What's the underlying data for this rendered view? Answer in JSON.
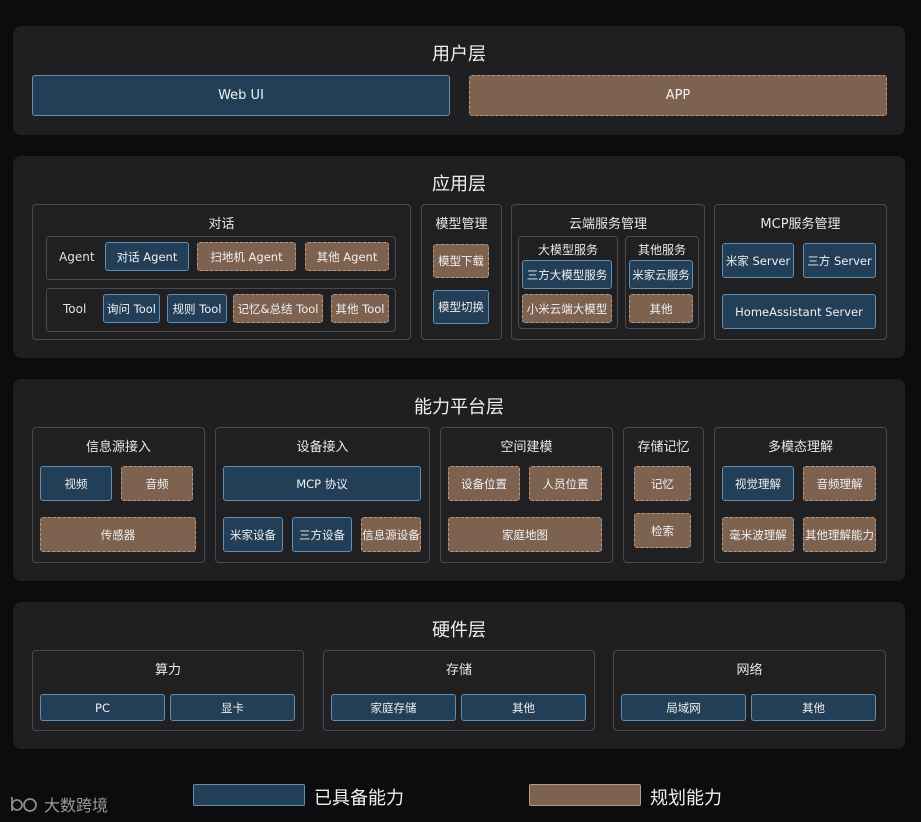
{
  "user_layer": {
    "title": "用户层",
    "web_ui": "Web UI",
    "app": "APP"
  },
  "app_layer": {
    "title": "应用层",
    "dialog": {
      "title": "对话",
      "agent_label": "Agent",
      "tool_label": "Tool",
      "agents": [
        "对话 Agent",
        "扫地机 Agent",
        "其他 Agent"
      ],
      "tools": [
        "询问 Tool",
        "规则 Tool",
        "记忆&总结 Tool",
        "其他 Tool"
      ]
    },
    "model_mgmt": {
      "title": "模型管理",
      "items": [
        "模型下载",
        "模型切换"
      ]
    },
    "cloud": {
      "title": "云端服务管理",
      "llm": {
        "title": "大模型服务",
        "items": [
          "三方大模型服务",
          "小米云端大模型"
        ]
      },
      "other": {
        "title": "其他服务",
        "items": [
          "米家云服务",
          "其他"
        ]
      }
    },
    "mcp": {
      "title": "MCP服务管理",
      "items": [
        "米家 Server",
        "三方 Server",
        "HomeAssistant Server"
      ]
    }
  },
  "platform_layer": {
    "title": "能力平台层",
    "info": {
      "title": "信息源接入",
      "items": [
        "视频",
        "音频",
        "传感器"
      ]
    },
    "device": {
      "title": "设备接入",
      "items": [
        "MCP 协议",
        "米家设备",
        "三方设备",
        "信息源设备"
      ]
    },
    "space": {
      "title": "空间建模",
      "items": [
        "设备位置",
        "人员位置",
        "家庭地图"
      ]
    },
    "memory": {
      "title": "存储记忆",
      "items": [
        "记忆",
        "检索"
      ]
    },
    "multimodal": {
      "title": "多模态理解",
      "items": [
        "视觉理解",
        "音频理解",
        "毫米波理解",
        "其他理解能力"
      ]
    }
  },
  "hardware_layer": {
    "title": "硬件层",
    "compute": {
      "title": "算力",
      "items": [
        "PC",
        "显卡"
      ]
    },
    "storage": {
      "title": "存储",
      "items": [
        "家庭存储",
        "其他"
      ]
    },
    "network": {
      "title": "网络",
      "items": [
        "局域网",
        "其他"
      ]
    }
  },
  "legend": {
    "have": "已具备能力",
    "plan": "规划能力",
    "have_color": "#223f57",
    "plan_color": "#7e6250"
  },
  "watermark": "大数跨境"
}
